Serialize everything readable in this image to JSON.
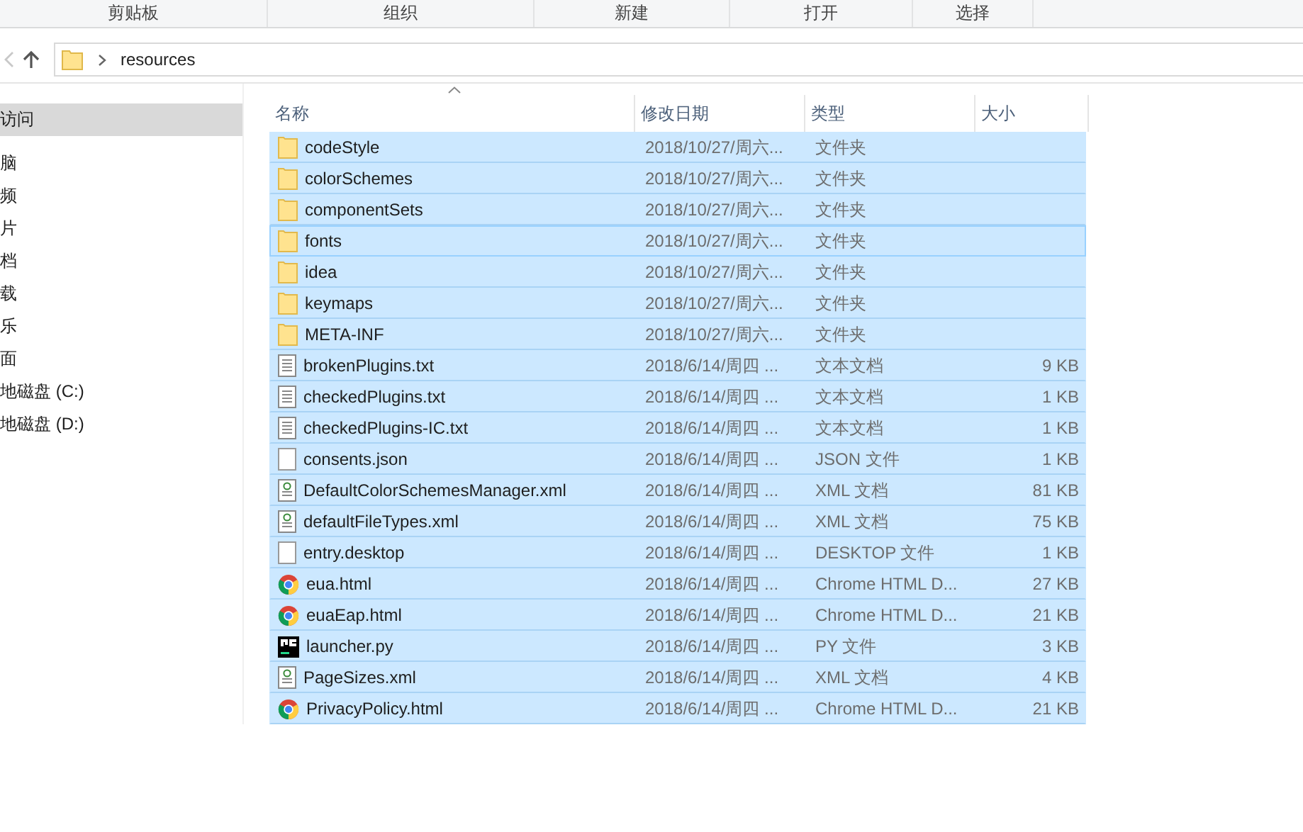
{
  "ribbon_groups": [
    "剪贴板",
    "组织",
    "新建",
    "打开",
    "选择"
  ],
  "address_bar": {
    "path": "resources"
  },
  "nav_pane": {
    "items": [
      {
        "label": "访问",
        "selected": true
      },
      {
        "label": "脑",
        "selected": false
      },
      {
        "label": "频",
        "selected": false
      },
      {
        "label": "片",
        "selected": false
      },
      {
        "label": "档",
        "selected": false
      },
      {
        "label": "载",
        "selected": false
      },
      {
        "label": "乐",
        "selected": false
      },
      {
        "label": "面",
        "selected": false
      },
      {
        "label": "地磁盘 (C:)",
        "selected": false
      },
      {
        "label": "地磁盘 (D:)",
        "selected": false
      }
    ]
  },
  "table": {
    "columns": [
      "名称",
      "修改日期",
      "类型",
      "大小"
    ],
    "rows": [
      {
        "kind": "folder",
        "name": "codeStyle",
        "date": "2018/10/27/周六...",
        "type": "文件夹",
        "size": "",
        "selected": true,
        "focused": false
      },
      {
        "kind": "folder",
        "name": "colorSchemes",
        "date": "2018/10/27/周六...",
        "type": "文件夹",
        "size": "",
        "selected": true,
        "focused": false
      },
      {
        "kind": "folder",
        "name": "componentSets",
        "date": "2018/10/27/周六...",
        "type": "文件夹",
        "size": "",
        "selected": true,
        "focused": false
      },
      {
        "kind": "folder",
        "name": "fonts",
        "date": "2018/10/27/周六...",
        "type": "文件夹",
        "size": "",
        "selected": true,
        "focused": true
      },
      {
        "kind": "folder",
        "name": "idea",
        "date": "2018/10/27/周六...",
        "type": "文件夹",
        "size": "",
        "selected": true,
        "focused": false
      },
      {
        "kind": "folder",
        "name": "keymaps",
        "date": "2018/10/27/周六...",
        "type": "文件夹",
        "size": "",
        "selected": true,
        "focused": false
      },
      {
        "kind": "folder",
        "name": "META-INF",
        "date": "2018/10/27/周六...",
        "type": "文件夹",
        "size": "",
        "selected": true,
        "focused": false
      },
      {
        "kind": "text",
        "name": "brokenPlugins.txt",
        "date": "2018/6/14/周四 ...",
        "type": "文本文档",
        "size": "9 KB",
        "selected": true,
        "focused": false
      },
      {
        "kind": "text",
        "name": "checkedPlugins.txt",
        "date": "2018/6/14/周四 ...",
        "type": "文本文档",
        "size": "1 KB",
        "selected": true,
        "focused": false
      },
      {
        "kind": "text",
        "name": "checkedPlugins-IC.txt",
        "date": "2018/6/14/周四 ...",
        "type": "文本文档",
        "size": "1 KB",
        "selected": true,
        "focused": false
      },
      {
        "kind": "blank",
        "name": "consents.json",
        "date": "2018/6/14/周四 ...",
        "type": "JSON 文件",
        "size": "1 KB",
        "selected": true,
        "focused": false
      },
      {
        "kind": "xml",
        "name": "DefaultColorSchemesManager.xml",
        "date": "2018/6/14/周四 ...",
        "type": "XML 文档",
        "size": "81 KB",
        "selected": true,
        "focused": false
      },
      {
        "kind": "xml",
        "name": "defaultFileTypes.xml",
        "date": "2018/6/14/周四 ...",
        "type": "XML 文档",
        "size": "75 KB",
        "selected": true,
        "focused": false
      },
      {
        "kind": "blank",
        "name": "entry.desktop",
        "date": "2018/6/14/周四 ...",
        "type": "DESKTOP 文件",
        "size": "1 KB",
        "selected": true,
        "focused": false
      },
      {
        "kind": "chrome",
        "name": "eua.html",
        "date": "2018/6/14/周四 ...",
        "type": "Chrome HTML D...",
        "size": "27 KB",
        "selected": true,
        "focused": false
      },
      {
        "kind": "chrome",
        "name": "euaEap.html",
        "date": "2018/6/14/周四 ...",
        "type": "Chrome HTML D...",
        "size": "21 KB",
        "selected": true,
        "focused": false
      },
      {
        "kind": "pycharm",
        "name": "launcher.py",
        "date": "2018/6/14/周四 ...",
        "type": "PY 文件",
        "size": "3 KB",
        "selected": true,
        "focused": false
      },
      {
        "kind": "xml",
        "name": "PageSizes.xml",
        "date": "2018/6/14/周四 ...",
        "type": "XML 文档",
        "size": "4 KB",
        "selected": true,
        "focused": false
      },
      {
        "kind": "chrome",
        "name": "PrivacyPolicy.html",
        "date": "2018/6/14/周四 ...",
        "type": "Chrome HTML D...",
        "size": "21 KB",
        "selected": true,
        "focused": false
      }
    ]
  }
}
